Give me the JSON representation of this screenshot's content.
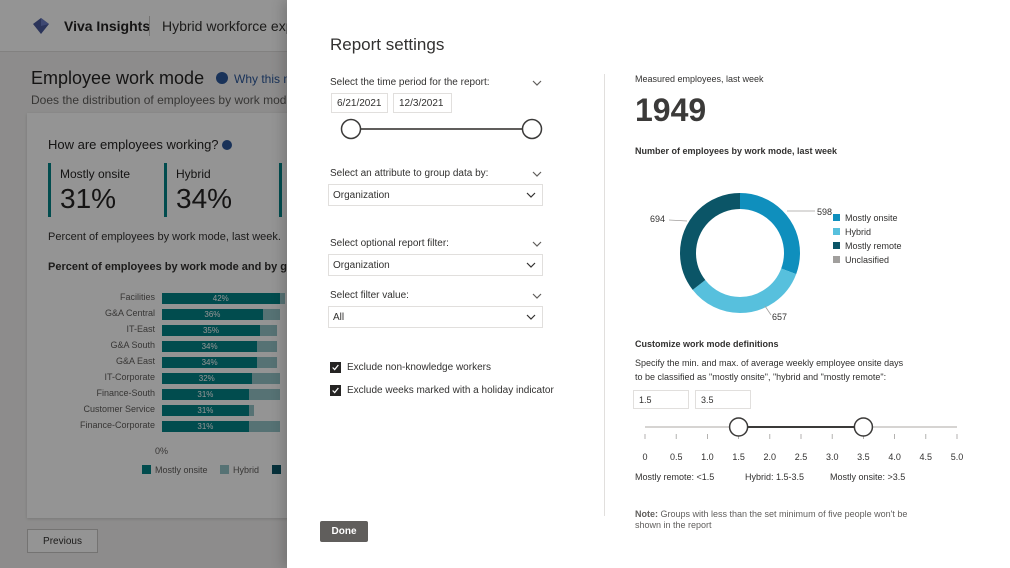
{
  "app": {
    "brand": "Viva Insights",
    "product": "Hybrid workforce expe"
  },
  "page": {
    "title": "Employee work mode",
    "why_link": "Why this m",
    "subtitle": "Does the distribution of employees by work mode m"
  },
  "card": {
    "title": "How are employees working?",
    "kpis": [
      {
        "label": "Mostly onsite",
        "value": "31%"
      },
      {
        "label": "Hybrid",
        "value": "34%"
      }
    ],
    "note": "Percent of employees by work mode, last week.",
    "chart_title": "Percent of employees by work mode and by gro",
    "axis_zero": "0%",
    "legend": [
      "Mostly onsite",
      "Hybrid"
    ],
    "previous_label": "Previous"
  },
  "chart_data": [
    {
      "type": "bar",
      "title": "Percent of employees by work mode and by gro",
      "categories": [
        "Facilities",
        "G&A Central",
        "IT-East",
        "G&A South",
        "G&A East",
        "IT-Corporate",
        "Finance-South",
        "Customer Service",
        "Finance-Corporate"
      ],
      "series": [
        {
          "name": "Mostly onsite",
          "values": [
            42,
            36,
            35,
            34,
            34,
            32,
            31,
            31,
            31
          ]
        },
        {
          "name": "Hybrid",
          "values": [
            2,
            6,
            6,
            7,
            7,
            10,
            11,
            2,
            11
          ]
        }
      ],
      "data_labels": [
        "42%",
        "36%",
        "35%",
        "34%",
        "34%",
        "32%",
        "31%",
        "31%",
        "31%"
      ],
      "x_axis_label": "0%"
    },
    {
      "type": "pie",
      "title": "Number of employees by work mode, last week",
      "categories": [
        "Mostly onsite",
        "Hybrid",
        "Mostly remote",
        "Unclasified"
      ],
      "values": [
        598,
        657,
        694,
        0
      ],
      "data_labels": [
        "598",
        "657",
        "694"
      ],
      "legend_placement": "right"
    }
  ],
  "panel": {
    "title": "Report settings",
    "time_period_label": "Select the time period for the report:",
    "start_date": "6/21/2021",
    "end_date": "12/3/2021",
    "group_by_label": "Select an attribute to group data by:",
    "group_by_value": "Organization",
    "filter_label": "Select optional report filter:",
    "filter_value": "Organization",
    "filter_value_label": "Select filter value:",
    "filter_value_value": "All",
    "checkbox_knowledge": "Exclude non-knowledge workers",
    "checkbox_holiday": "Exclude weeks marked with a holiday indicator",
    "done_label": "Done",
    "measured_label": "Measured employees, last week",
    "measured_value": "1949",
    "donut_title": "Number of employees by work mode, last week",
    "donut_legend": [
      {
        "label": "Mostly onsite",
        "color": "#0f8fbd"
      },
      {
        "label": "Hybrid",
        "color": "#57c0dd"
      },
      {
        "label": "Mostly remote",
        "color": "#0b5567"
      },
      {
        "label": "Unclasified",
        "color": "#a19f9d"
      }
    ],
    "customize_title": "Customize work mode definitions",
    "customize_desc_1": "Specify the min. and max. of average weekly employee onsite days",
    "customize_desc_2": "to be classified as \"mostly onsite\", \"hybrid and \"mostly remote\":",
    "range_min": "1.5",
    "range_max": "3.5",
    "scale_ticks": [
      "0",
      "0.5",
      "1.0",
      "1.5",
      "2.0",
      "2.5",
      "3.0",
      "3.5",
      "4.0",
      "4.5",
      "5.0"
    ],
    "slider_low": 1.5,
    "slider_high": 3.5,
    "slider_max": 5.0,
    "summary_remote": "Mostly remote:  <1.5",
    "summary_hybrid": "Hybrid:  1.5-3.5",
    "summary_onsite": "Mostly onsite:  >3.5",
    "note_bold": "Note:",
    "note_text": " Groups with less than the set minimum of five people won't be shown in the report"
  },
  "colors": {
    "teal": "#038387",
    "teal_light": "#94c5c8",
    "onsite": "#0f8fbd",
    "hybrid": "#57c0dd",
    "remote": "#0b5567"
  }
}
